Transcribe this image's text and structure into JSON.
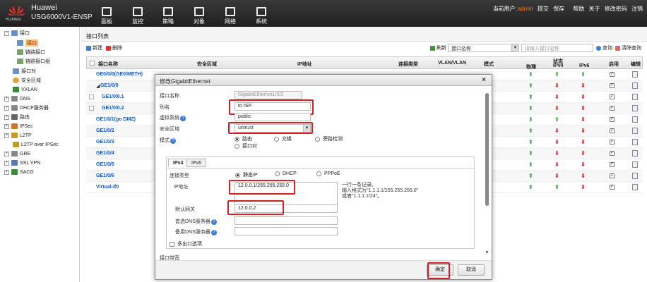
{
  "brand": {
    "logo_text": "HUAWEI",
    "vendor": "Huawei",
    "model": "USG6000V1-ENSP"
  },
  "nav": [
    "面板",
    "监控",
    "策略",
    "对象",
    "网络",
    "系统"
  ],
  "top_right": {
    "user_label": "当前用户:",
    "user": "admin",
    "links": [
      "提交",
      "保存",
      "帮助",
      "关于",
      "修改密码",
      "注销"
    ]
  },
  "sidebar": [
    {
      "label": "接口",
      "toggle": "□"
    },
    {
      "label": "接口",
      "selected": true
    },
    {
      "label": "链路接口"
    },
    {
      "label": "链路接口组"
    },
    {
      "label": "接口对"
    },
    {
      "label": "安全区域"
    },
    {
      "label": "VXLAN"
    },
    {
      "label": "DNS",
      "toggle": "+"
    },
    {
      "label": "DHCP服务器",
      "toggle": "+"
    },
    {
      "label": "路由",
      "toggle": "+"
    },
    {
      "label": "IPSec",
      "toggle": "+"
    },
    {
      "label": "L2TP",
      "toggle": "+"
    },
    {
      "label": "L2TP over IPSec"
    },
    {
      "label": "GRE",
      "toggle": "+"
    },
    {
      "label": "SSL VPN",
      "toggle": "+"
    },
    {
      "label": "SACG",
      "toggle": "+"
    }
  ],
  "main": {
    "title": "接口列表",
    "new_label": "新建",
    "delete_label": "删除",
    "refresh_label": "刷新",
    "filter_select": "接口名称",
    "search_placeholder": "请输入接口名称",
    "search_label": "查询",
    "clear_label": "清除查询"
  },
  "table": {
    "headers": [
      "接口名称",
      "安全区域",
      "IP地址",
      "连接类型",
      "VLAN/VLAN",
      "模式",
      "状态",
      "物理",
      "IPv4",
      "IPv6",
      "启用",
      "编辑"
    ],
    "rows": [
      {
        "name": "GE0/0/0(GE0/METH)",
        "phy": "up",
        "v4": "up",
        "v6": "up"
      },
      {
        "name": "GE1/0/0",
        "phy": "up",
        "v4": "down",
        "v6": "down",
        "toggle": "◢"
      },
      {
        "name": "GE1/0/0.1",
        "phy": "up",
        "v4": "down",
        "v6": "down",
        "cb": true
      },
      {
        "name": "GE1/0/0.2",
        "phy": "up",
        "v4": "down",
        "v6": "down",
        "cb": true
      },
      {
        "name": "GE1/0/1(go DMZ)",
        "phy": "up",
        "v4": "up",
        "v6": "down"
      },
      {
        "name": "GE1/0/2",
        "phy": "up",
        "v4": "down",
        "v6": "down"
      },
      {
        "name": "GE1/0/3",
        "phy": "up",
        "v4": "down",
        "v6": "down"
      },
      {
        "name": "GE1/0/4",
        "phy": "up",
        "v4": "down",
        "v6": "down"
      },
      {
        "name": "GE1/0/5",
        "phy": "up",
        "v4": "down",
        "v6": "down"
      },
      {
        "name": "GE1/0/6",
        "phy": "up",
        "v4": "down",
        "v6": "down"
      },
      {
        "name": "Virtual-if0",
        "phy": "up",
        "v4": "up",
        "v6": "down"
      }
    ]
  },
  "dialog": {
    "title": "修改GigabitEthernet",
    "close": "×",
    "ifname_label": "接口名称",
    "ifname_value": "GigabitEthernet1/0/2",
    "alias_label": "别名",
    "alias_value": "to ISP",
    "vsys_label": "虚拟系统",
    "vsys_value": "public",
    "zone_label": "安全区域",
    "zone_value": "untrust",
    "mode_label": "模式",
    "mode_options": [
      "路由",
      "交换",
      "旁路检测",
      "接口对"
    ],
    "tabs": [
      "IPv4",
      "IPv6"
    ],
    "conn_label": "连接类型",
    "conn_options": [
      "静态IP",
      "DHCP",
      "PPPoE"
    ],
    "ip_label": "IP地址",
    "ip_value": "12.0.0.1/255.255.255.0",
    "hint": [
      "一行一条记录。",
      "输入格式为\"1.1.1.1/255.255.255.0\"",
      "或者\"1.1.1.1/24\"。"
    ],
    "gw_label": "默认网关",
    "gw_value": "12.0.0.2",
    "dns1_label": "首选DNS服务器",
    "dns2_label": "备用DNS服务器",
    "multi_label": "多出口选项",
    "bw_label": "接口带宽",
    "ok": "确定",
    "cancel": "取消"
  }
}
